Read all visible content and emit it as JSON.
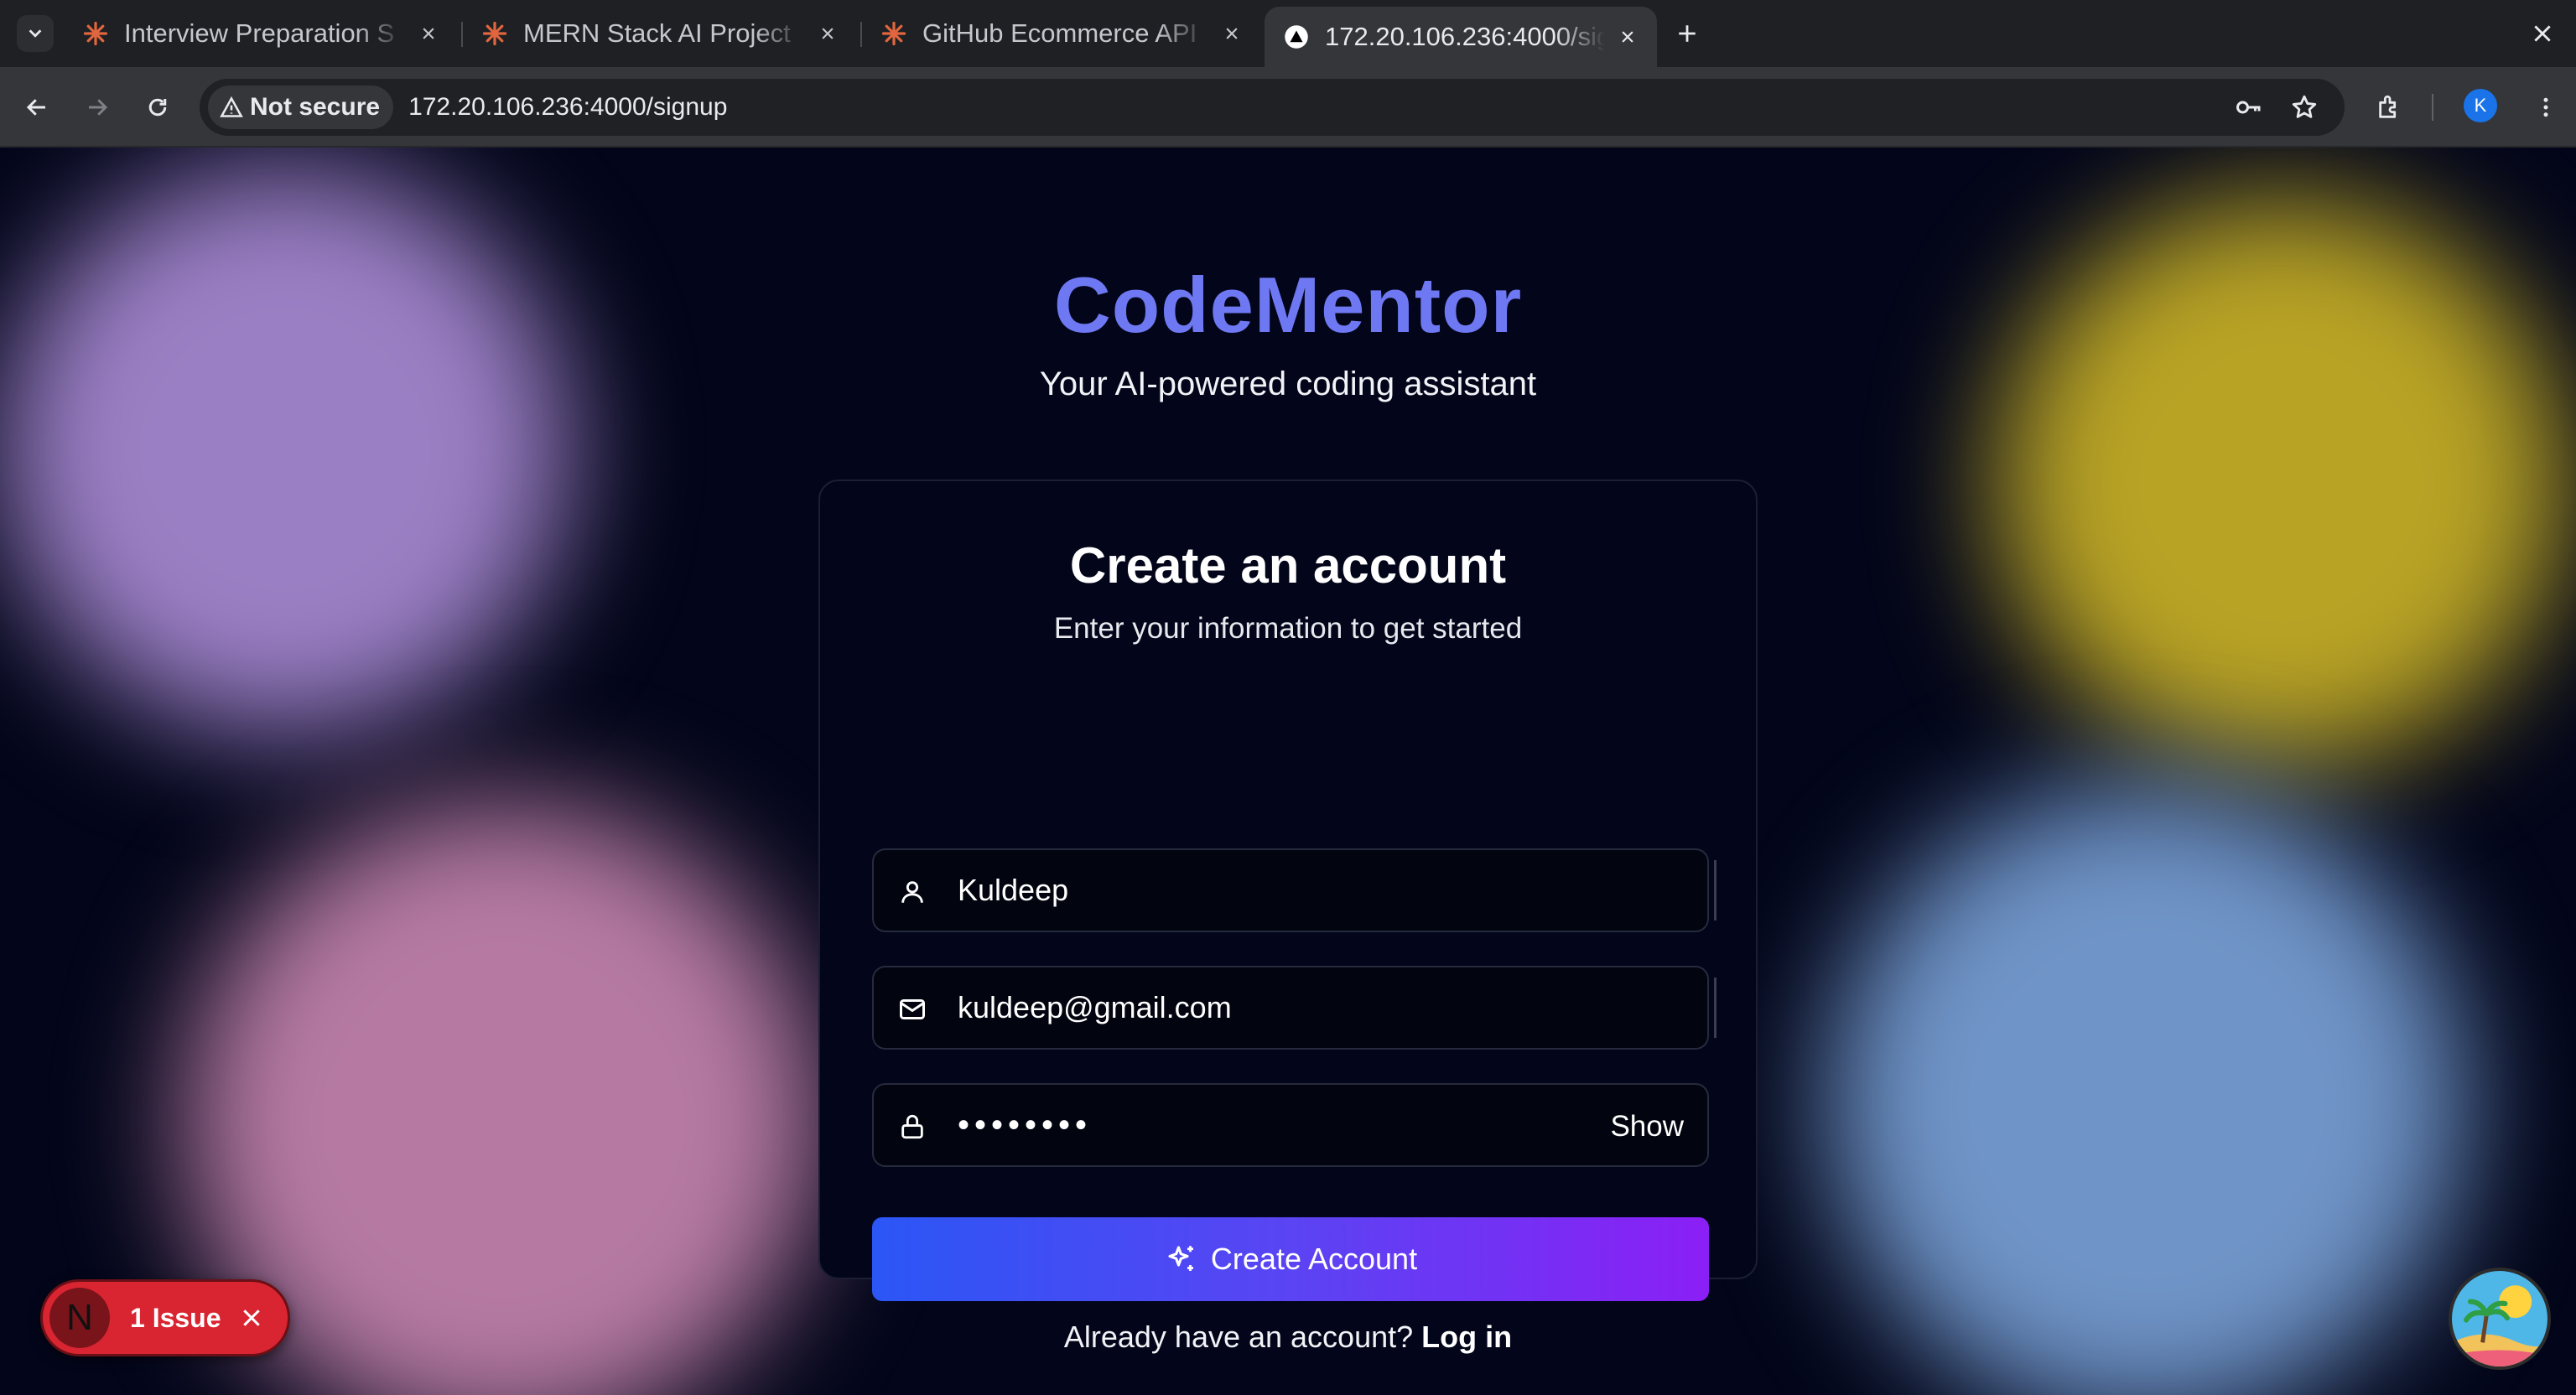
{
  "browser": {
    "tabs": [
      {
        "title": "Interview Preparation S",
        "favicon": "sparkle-orange-icon",
        "active": false
      },
      {
        "title": "MERN Stack AI Project",
        "favicon": "sparkle-orange-icon",
        "active": false
      },
      {
        "title": "GitHub Ecommerce API",
        "favicon": "sparkle-orange-icon",
        "active": false
      },
      {
        "title": "172.20.106.236:4000/signup",
        "favicon": "triangle-icon",
        "active": true
      }
    ],
    "security_label": "Not secure",
    "url": "172.20.106.236:4000/signup",
    "profile_initial": "K"
  },
  "page": {
    "brand": "CodeMentor",
    "tagline": "Your AI-powered coding assistant"
  },
  "form": {
    "title": "Create an account",
    "subtitle": "Enter your information to get started",
    "name_value": "Kuldeep",
    "email_value": "kuldeep@gmail.com",
    "password_value": "••••••••",
    "show_label": "Show",
    "submit_label": "Create Account",
    "login_prompt": "Already have an account?",
    "login_link": "Log in"
  },
  "dev_overlay": {
    "logo_letter": "N",
    "issue_text": "1 Issue"
  },
  "colors": {
    "brand": "#6e78f2",
    "button_start": "#2b56f5",
    "button_end": "#8b1ff5",
    "issue_red": "#d92531",
    "background": "#03061a"
  }
}
